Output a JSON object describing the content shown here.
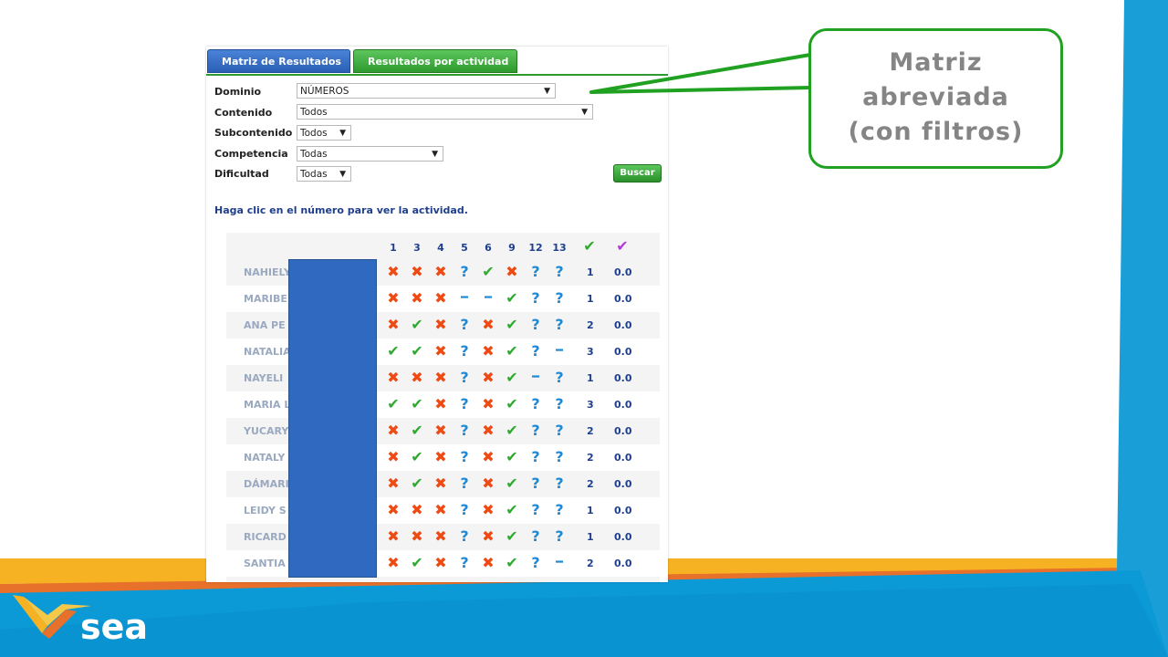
{
  "tabs": [
    {
      "label": "Matriz de Resultados"
    },
    {
      "label": "Resultados por actividad"
    }
  ],
  "filters": {
    "dominio": {
      "label": "Dominio",
      "value": "NÚMEROS"
    },
    "contenido": {
      "label": "Contenido",
      "value": "Todos"
    },
    "subcontenido": {
      "label": "Subcontenido",
      "value": "Todos"
    },
    "competencia": {
      "label": "Competencia",
      "value": "Todas"
    },
    "dificultad": {
      "label": "Dificultad",
      "value": "Todas"
    }
  },
  "search_button": "Buscar",
  "hint": "Haga clic en el número para ver la actividad.",
  "matrix": {
    "columns": [
      "1",
      "3",
      "4",
      "5",
      "6",
      "9",
      "12",
      "13"
    ],
    "summary_icons": [
      "check-green",
      "check-purple"
    ],
    "rows": [
      {
        "name": "NAHIELY",
        "marks": [
          "x",
          "x",
          "x",
          "?",
          "v",
          "x",
          "?",
          "?"
        ],
        "correct": "1",
        "score": "0.0"
      },
      {
        "name": "MARIBE",
        "marks": [
          "x",
          "x",
          "x",
          "-",
          "-",
          "v",
          "?",
          "?"
        ],
        "correct": "1",
        "score": "0.0"
      },
      {
        "name": "ANA PE",
        "marks": [
          "x",
          "v",
          "x",
          "?",
          "x",
          "v",
          "?",
          "?"
        ],
        "correct": "2",
        "score": "0.0"
      },
      {
        "name": "NATALIA",
        "marks": [
          "v",
          "v",
          "x",
          "?",
          "x",
          "v",
          "?",
          "-"
        ],
        "correct": "3",
        "score": "0.0"
      },
      {
        "name": "NAYELI",
        "marks": [
          "x",
          "x",
          "x",
          "?",
          "x",
          "v",
          "-",
          "?"
        ],
        "correct": "1",
        "score": "0.0"
      },
      {
        "name": "MARIA L",
        "marks": [
          "v",
          "v",
          "x",
          "?",
          "x",
          "v",
          "?",
          "?"
        ],
        "correct": "3",
        "score": "0.0"
      },
      {
        "name": "YUCARY",
        "marks": [
          "x",
          "v",
          "x",
          "?",
          "x",
          "v",
          "?",
          "?"
        ],
        "correct": "2",
        "score": "0.0"
      },
      {
        "name": "NATALY",
        "marks": [
          "x",
          "v",
          "x",
          "?",
          "x",
          "v",
          "?",
          "?"
        ],
        "correct": "2",
        "score": "0.0"
      },
      {
        "name": "DÁMARI",
        "marks": [
          "x",
          "v",
          "x",
          "?",
          "x",
          "v",
          "?",
          "?"
        ],
        "correct": "2",
        "score": "0.0"
      },
      {
        "name": "LEIDY S",
        "marks": [
          "x",
          "x",
          "x",
          "?",
          "x",
          "v",
          "?",
          "?"
        ],
        "correct": "1",
        "score": "0.0"
      },
      {
        "name": "RICARD",
        "marks": [
          "x",
          "x",
          "x",
          "?",
          "x",
          "v",
          "?",
          "?"
        ],
        "correct": "1",
        "score": "0.0"
      },
      {
        "name": "SANTIA",
        "marks": [
          "x",
          "v",
          "x",
          "?",
          "x",
          "v",
          "?",
          "-"
        ],
        "correct": "2",
        "score": "0.0"
      }
    ]
  },
  "callout": {
    "lines": [
      "Matriz",
      "abreviada",
      "(con filtros)"
    ]
  },
  "logo": {
    "text": "sea"
  },
  "colors": {
    "check": "#2eaa2e",
    "cross": "#ee4a14",
    "question": "#1e8ad6",
    "accent_green": "#21a121",
    "tab_blue": "#2a5fb4"
  }
}
